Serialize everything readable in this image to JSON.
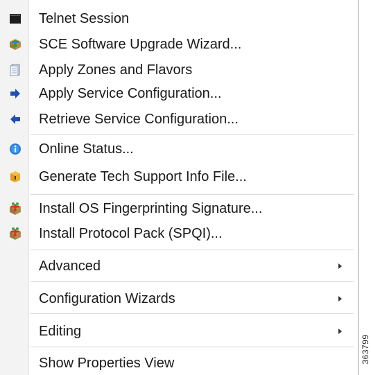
{
  "menu": {
    "items": [
      {
        "label": "Telnet Session",
        "icon": "terminal-icon"
      },
      {
        "label": "SCE Software Upgrade Wizard...",
        "icon": "upgrade-package-icon"
      },
      {
        "label": "Apply Zones and Flavors",
        "icon": "document-icon"
      },
      {
        "label": "Apply Service Configuration...",
        "icon": "arrow-right-icon"
      },
      {
        "label": "Retrieve Service Configuration...",
        "icon": "arrow-left-icon"
      },
      {
        "label": "Online Status...",
        "icon": "info-icon"
      },
      {
        "label": "Generate Tech Support Info File...",
        "icon": "support-package-icon"
      },
      {
        "label": "Install OS Fingerprinting Signature...",
        "icon": "install-package-icon"
      },
      {
        "label": "Install Protocol Pack (SPQI)...",
        "icon": "install-package-icon"
      },
      {
        "label": "Advanced",
        "submenu": true
      },
      {
        "label": "Configuration Wizards",
        "submenu": true
      },
      {
        "label": "Editing",
        "submenu": true
      },
      {
        "label": "Show Properties View"
      }
    ]
  },
  "figure_id": "363799",
  "colors": {
    "gutter": "#f3f3f3",
    "separator": "#d8d8d8",
    "text": "#1a1a1a",
    "info_blue": "#1f7bd8",
    "arrow_blue": "#1e4fb5"
  }
}
